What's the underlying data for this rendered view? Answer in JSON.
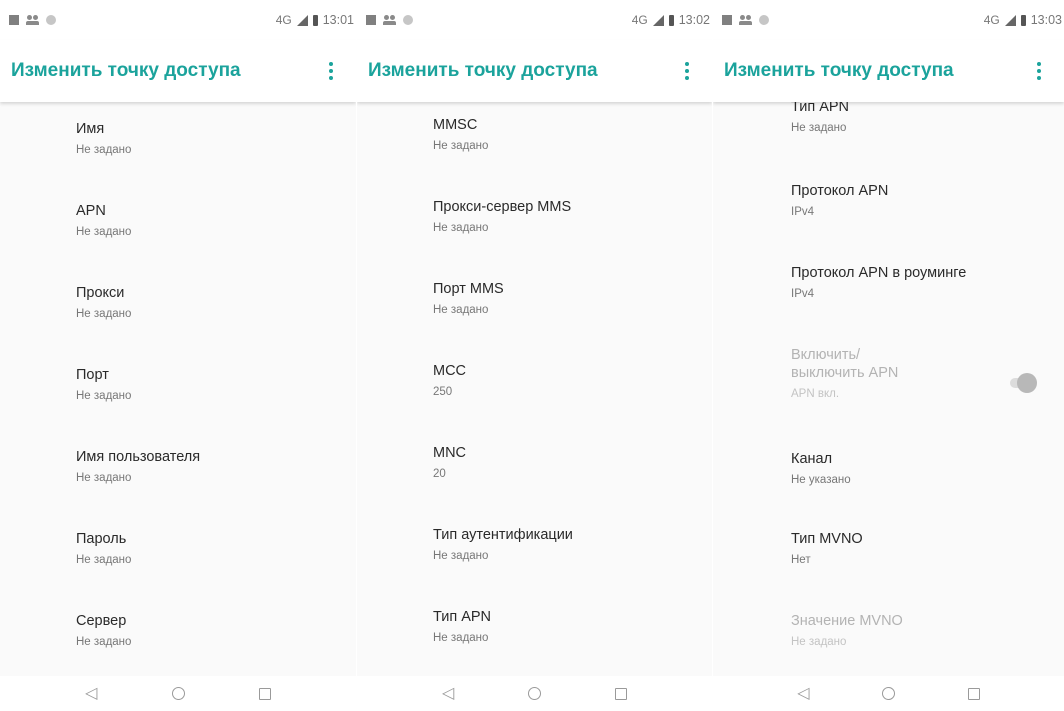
{
  "accent_color": "#1ba39c",
  "screens": [
    {
      "status": {
        "network": "4G",
        "time": "13:01",
        "icons": [
          "image-icon",
          "people-icon",
          "circle-icon",
          "signal-icon",
          "battery-icon"
        ]
      },
      "title": "Изменить точку доступа",
      "items": [
        {
          "title": "Имя",
          "summary": "Не задано"
        },
        {
          "title": "APN",
          "summary": "Не задано"
        },
        {
          "title": "Прокси",
          "summary": "Не задано"
        },
        {
          "title": "Порт",
          "summary": "Не задано"
        },
        {
          "title": "Имя пользователя",
          "summary": "Не задано"
        },
        {
          "title": "Пароль",
          "summary": "Не задано"
        },
        {
          "title": "Сервер",
          "summary": "Не задано"
        }
      ]
    },
    {
      "status": {
        "network": "4G",
        "time": "13:02",
        "icons": [
          "image-icon",
          "people-icon",
          "circle-icon",
          "signal-icon",
          "battery-icon"
        ]
      },
      "title": "Изменить точку доступа",
      "items": [
        {
          "title": "MMSC",
          "summary": "Не задано"
        },
        {
          "title": "Прокси-сервер MMS",
          "summary": "Не задано"
        },
        {
          "title": "Порт MMS",
          "summary": "Не задано"
        },
        {
          "title": "MCC",
          "summary": "250"
        },
        {
          "title": "MNC",
          "summary": "20"
        },
        {
          "title": "Тип аутентификации",
          "summary": "Не задано"
        },
        {
          "title": "Тип APN",
          "summary": "Не задано"
        }
      ]
    },
    {
      "status": {
        "network": "4G",
        "time": "13:03",
        "icons": [
          "image-icon",
          "people-icon",
          "circle-icon",
          "signal-icon",
          "battery-icon"
        ]
      },
      "title": "Изменить точку доступа",
      "items": [
        {
          "title": "Тип APN",
          "summary": "Не задано"
        },
        {
          "title": "Протокол APN",
          "summary": "IPv4"
        },
        {
          "title": "Протокол APN в роуминге",
          "summary": "IPv4"
        },
        {
          "title_line1": "Включить/",
          "title_line2": "выключить APN",
          "summary": "APN вкл.",
          "disabled": true,
          "toggle": true
        },
        {
          "title": "Канал",
          "summary": "Не указано"
        },
        {
          "title": "Тип MVNO",
          "summary": "Нет"
        },
        {
          "title": "Значение MVNO",
          "summary": "Не задано",
          "disabled": true
        }
      ]
    }
  ],
  "nav_icons": [
    "back-icon",
    "home-icon",
    "recents-icon"
  ]
}
